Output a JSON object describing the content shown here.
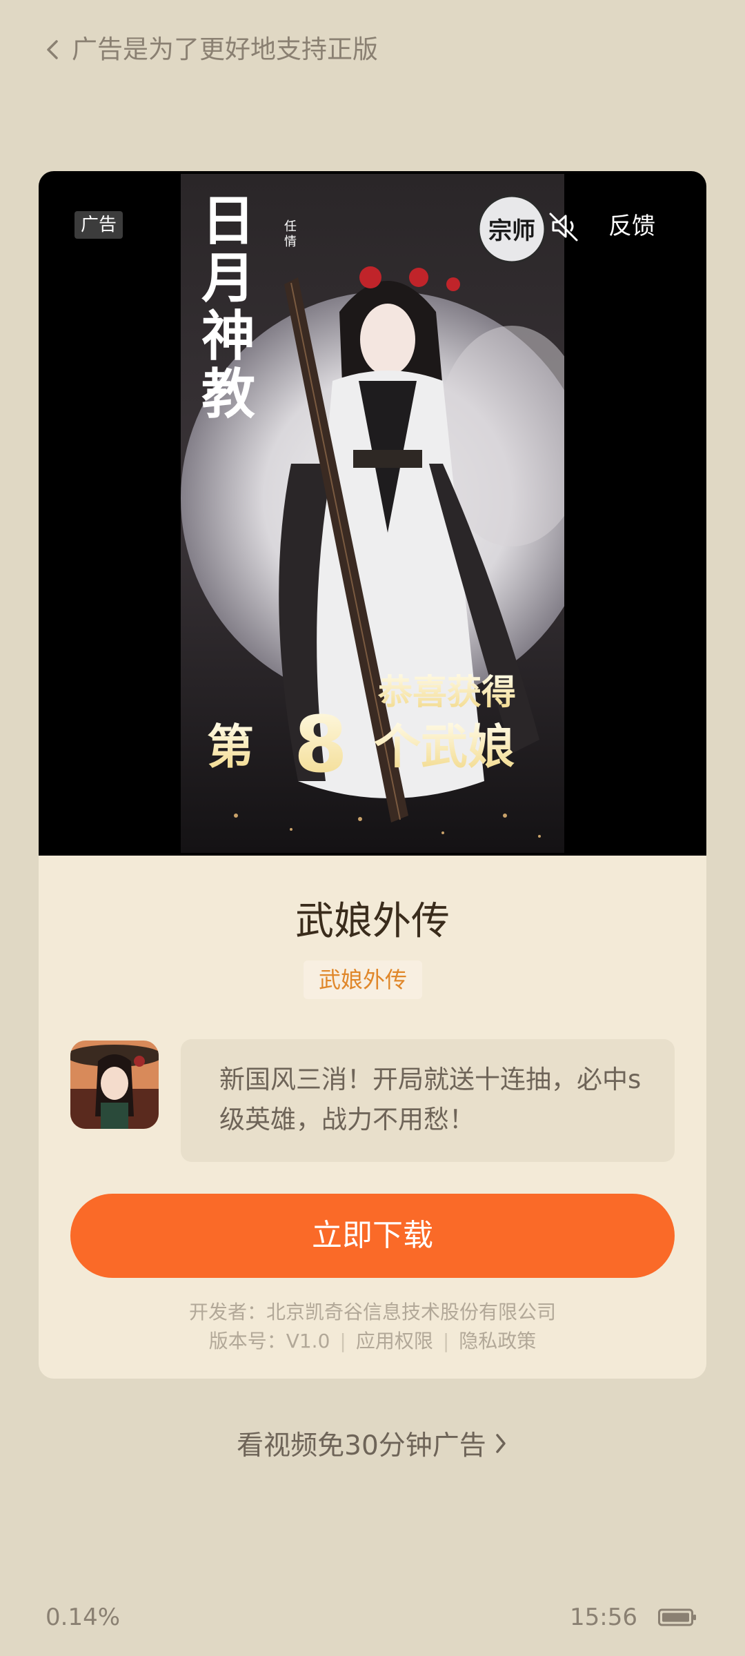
{
  "header": {
    "title": "广告是为了更好地支持正版"
  },
  "ad": {
    "badge": "广告",
    "feedback": "反馈"
  },
  "app": {
    "name": "武娘外传",
    "tag": "武娘外传",
    "description": "新国风三消！开局就送十连抽，必中s级英雄，战力不用愁！",
    "download_label": "立即下载",
    "developer": "开发者：北京凯奇谷信息技术股份有限公司",
    "version": "版本号：V1.0",
    "permissions": "应用权限",
    "privacy": "隐私政策"
  },
  "poster": {
    "title": "日月神教",
    "side_tag": "任情",
    "seal": "宗师",
    "congrats": "恭喜获得",
    "prize_prefix": "第",
    "prize_number": "8",
    "prize_suffix": "个武娘"
  },
  "watch_video": {
    "label": "看视频免30分钟广告"
  },
  "status_bar": {
    "progress": "0.14%",
    "time": "15:56"
  },
  "colors": {
    "background": "#e0d8c4",
    "card": "#f3ead7",
    "accent": "#fa6a28",
    "tag_text": "#e0872a"
  },
  "icons": [
    "back-chevron-icon",
    "mute-icon",
    "chevron-right-icon",
    "battery-icon"
  ]
}
